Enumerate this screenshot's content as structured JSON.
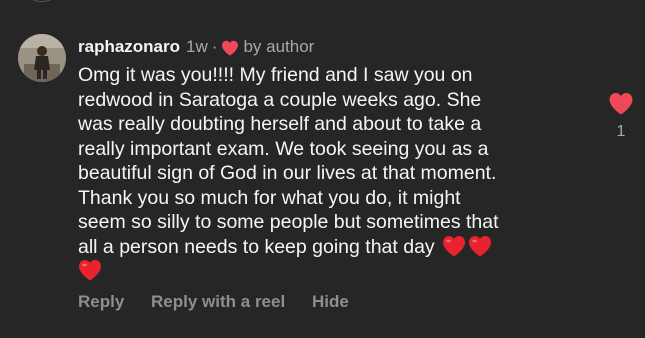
{
  "comment": {
    "username": "raphazonaro",
    "time": "1w",
    "separator": "·",
    "author_badge": "by author",
    "text_lines": [
      "Omg it was you!!!! My friend and I saw you on",
      "redwood in Saratoga a couple weeks ago. She",
      "was really doubting herself and about to take a",
      "really important exam. We took seeing you as a",
      "beautiful sign of God in our lives at that moment.",
      "Thank you so much for what you do, it might",
      "seem so silly to some people but sometimes that",
      "all a person needs to keep going that day"
    ],
    "trailing_emojis": [
      "red-heart",
      "red-heart",
      "red-heart"
    ],
    "like_count": "1",
    "actions": {
      "reply": "Reply",
      "reply_with_reel": "Reply with a reel",
      "hide": "Hide"
    }
  },
  "colors": {
    "background": "#262626",
    "heart": "#ed4956",
    "primary_text": "#f5f5f5",
    "secondary_text": "#a8a8a8"
  },
  "icons": {
    "author_liked": "heart-icon",
    "like": "heart-icon",
    "avatar": "profile-photo"
  }
}
